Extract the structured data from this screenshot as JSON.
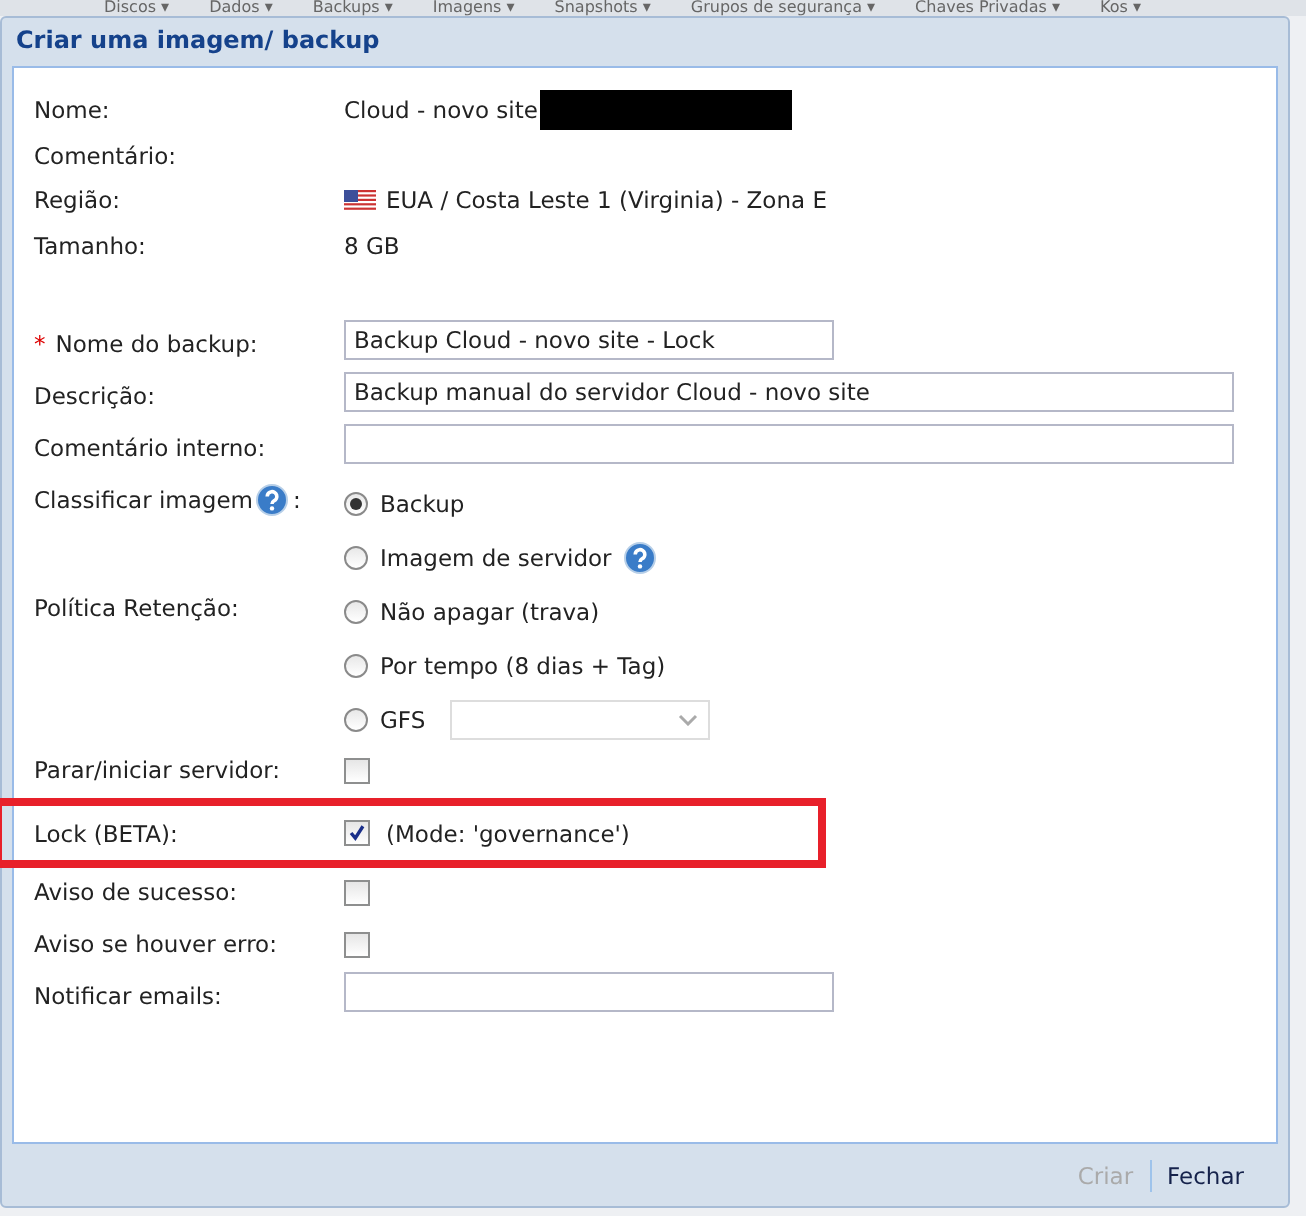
{
  "menu_bar": {
    "items": [
      "Discos ▾",
      "Dados ▾",
      "Backups ▾",
      "Imagens ▾",
      "Snapshots ▾",
      "Grupos de segurança ▾",
      "Chaves Privadas ▾",
      "Kos ▾"
    ]
  },
  "dialog": {
    "title": "Criar uma imagem/ backup",
    "info_rows": [
      {
        "label": "Nome:",
        "value": "Cloud - novo site",
        "redacted": true
      },
      {
        "label": "Comentário:"
      },
      {
        "label": "Região:",
        "value": "EUA / Costa Leste 1 (Virginia) - Zona E",
        "flag": true
      },
      {
        "label": "Tamanho:",
        "value": "8 GB"
      }
    ],
    "form_rows": [
      {
        "kind": "text",
        "label": "Nome do backup:",
        "required": true,
        "required_mark": "*",
        "value": "Backup Cloud - novo site - Lock",
        "wide": false
      },
      {
        "kind": "text",
        "label": "Descrição:",
        "value": "Backup manual do servidor Cloud - novo site",
        "wide": true
      },
      {
        "kind": "text",
        "label": "Comentário interno:",
        "wide": true
      },
      {
        "kind": "radio",
        "label": "Classificar imagem",
        "label_help": true,
        "label_suffix": ":",
        "options": [
          {
            "label": "Backup",
            "selected": true
          },
          {
            "label": "Imagem de servidor",
            "selected": false,
            "help": true
          }
        ]
      },
      {
        "kind": "radio",
        "label": "Política Retenção:",
        "options": [
          {
            "label": "Não apagar (trava)",
            "selected": false
          },
          {
            "label": "Por tempo (8 dias + Tag)",
            "selected": false
          },
          {
            "label": "GFS",
            "selected": false,
            "dropdown": true
          }
        ]
      },
      {
        "kind": "checkbox",
        "label": "Parar/iniciar servidor:",
        "checked": false,
        "highlighted": false
      },
      {
        "kind": "checkbox",
        "label": "Lock (BETA):",
        "checked": true,
        "note": "(Mode: 'governance')",
        "highlighted": true
      },
      {
        "kind": "checkbox",
        "label": "Aviso de sucesso:",
        "checked": false,
        "highlighted": false
      },
      {
        "kind": "checkbox",
        "label": "Aviso se houver erro:",
        "checked": false,
        "highlighted": false
      },
      {
        "kind": "text",
        "label": "Notificar emails:",
        "wide": false
      }
    ],
    "buttons": [
      {
        "label": "Criar",
        "disabled": true
      },
      {
        "label": "Fechar",
        "disabled": false
      }
    ]
  }
}
